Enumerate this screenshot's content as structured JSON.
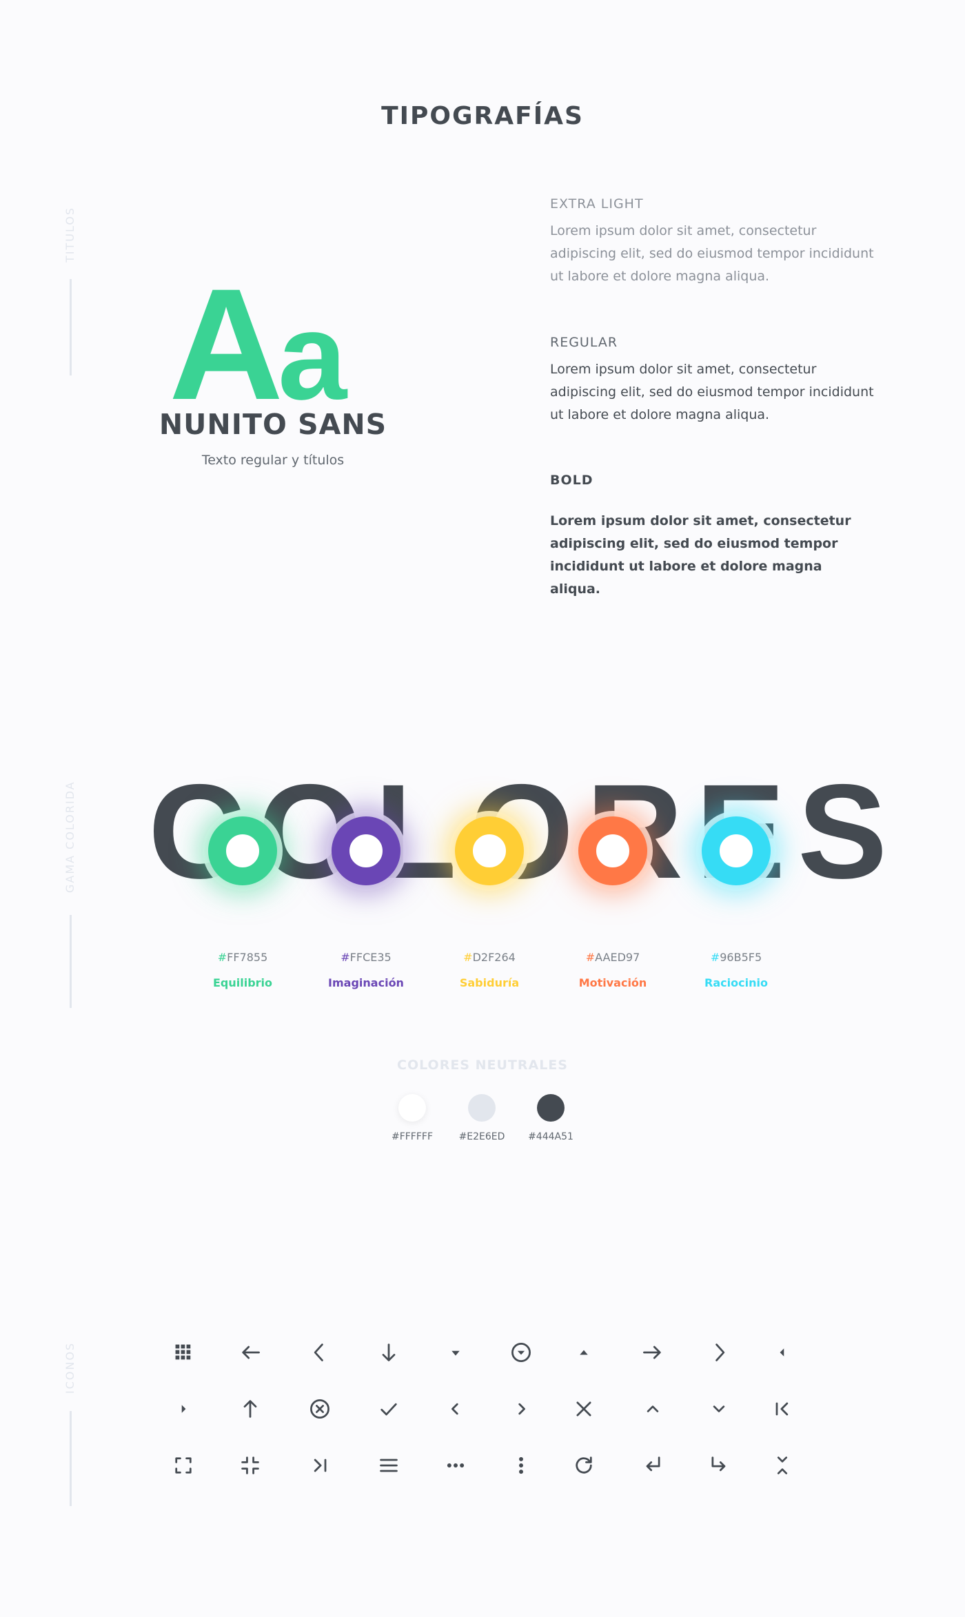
{
  "typography": {
    "title": "TIPOGRAFÍAS",
    "side_label": "TITULOS",
    "specimen": {
      "big": "A",
      "small": "a"
    },
    "font_name": "NUNITO SANS",
    "font_subtitle": "Texto regular y títulos",
    "weights": [
      {
        "label": "EXTRA LIGHT",
        "sample": "Lorem ipsum dolor sit amet, consectetur adipiscing elit, sed do eiusmod tempor incididunt ut labore et dolore magna aliqua."
      },
      {
        "label": "REGULAR",
        "sample": "Lorem ipsum dolor sit amet, consectetur adipiscing elit, sed do eiusmod tempor incididunt ut labore et dolore magna aliqua."
      },
      {
        "label": "BOLD",
        "sample": "Lorem ipsum dolor sit amet, consectetur adipiscing elit, sed do eiusmod tempor incididunt ut labore et dolore magna aliqua."
      }
    ]
  },
  "colors": {
    "side_label": "GAMA COLORIDA",
    "word": "COLORES",
    "swatches": [
      {
        "hash": "#",
        "code": "FF7855",
        "name": "Equilibrio",
        "color": "#3AD394",
        "glow": "rgba(58,211,148,0.55)"
      },
      {
        "hash": "#",
        "code": "FFCE35",
        "name": "Imaginación",
        "color": "#6A46B5",
        "glow": "rgba(106,70,181,0.5)"
      },
      {
        "hash": "#",
        "code": "D2F264",
        "name": "Sabiduría",
        "color": "#FFCE35",
        "glow": "rgba(255,206,53,0.6)"
      },
      {
        "hash": "#",
        "code": "AAED97",
        "name": "Motivación",
        "color": "#FF7846",
        "glow": "rgba(255,120,70,0.55)"
      },
      {
        "hash": "#",
        "code": "96B5F5",
        "name": "Raciocinio",
        "color": "#36DCF5",
        "glow": "rgba(54,220,245,0.55)"
      }
    ],
    "neutral_title": "COLORES NEUTRALES",
    "neutrals": [
      {
        "hex": "#FFFFFF",
        "color": "#FFFFFF"
      },
      {
        "hex": "#E2E6ED",
        "color": "#E2E6ED"
      },
      {
        "hex": "#444A51",
        "color": "#444A51"
      }
    ]
  },
  "icons": {
    "side_label": "ICONOS",
    "rows": [
      [
        "apps-grid-icon",
        "arrow-left-icon",
        "chevron-left-icon",
        "arrow-down-icon",
        "caret-down-icon",
        "dropdown-circle-icon",
        "caret-up-icon",
        "arrow-right-icon",
        "chevron-right-icon",
        "caret-left-icon"
      ],
      [
        "caret-right-icon",
        "arrow-up-icon",
        "cancel-circle-icon",
        "check-icon",
        "chevron-left-small-icon",
        "chevron-right-small-icon",
        "close-icon",
        "chevron-up-icon",
        "chevron-down-icon",
        "first-page-icon"
      ],
      [
        "fullscreen-icon",
        "fullscreen-exit-icon",
        "last-page-icon",
        "menu-icon",
        "more-horiz-icon",
        "more-vert-icon",
        "refresh-icon",
        "subdirectory-arrow-left-icon",
        "subdirectory-arrow-right-icon",
        "unfold-less-icon"
      ]
    ],
    "color": "#444A51"
  }
}
